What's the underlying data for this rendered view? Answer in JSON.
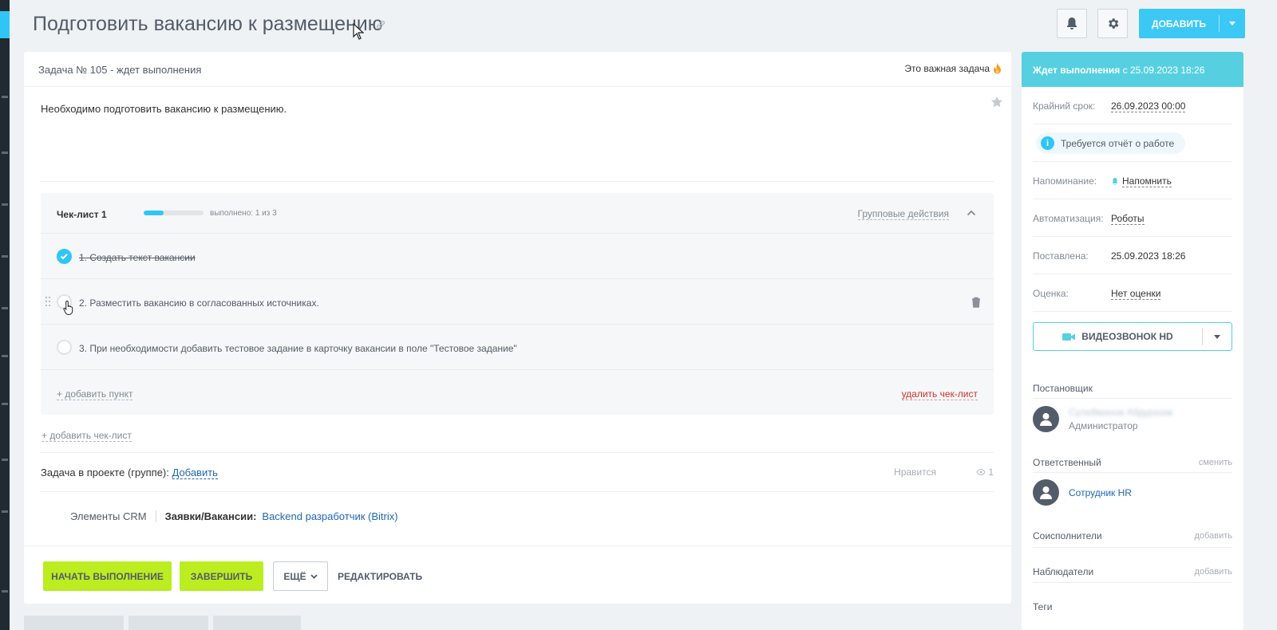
{
  "header": {
    "title": "Подготовить вакансию к размещению",
    "add_label": "ДОБАВИТЬ"
  },
  "task": {
    "heading": "Задача № 105 - ждет выполнения",
    "important_label": "Это важная задача",
    "description": "Необходимо подготовить вакансию к размещению."
  },
  "checklist": {
    "title": "Чек-лист 1",
    "progress": 0.333,
    "done_text": "выполнено: 1 из 3",
    "group_actions": "Групповые действия",
    "items": [
      {
        "text": "1. Создать текст вакансии",
        "done": true
      },
      {
        "text": "2. Разместить вакансию в согласованных источниках.",
        "done": false
      },
      {
        "text": "3. При необходимости добавить тестовое задание в карточку вакансии в поле \"Тестовое задание\"",
        "done": false
      }
    ],
    "add_item": "+ добавить пункт",
    "delete_checklist": "удалить чек-лист"
  },
  "add_checklist": "+ добавить чек-лист",
  "project": {
    "label": "Задача в проекте (группе):",
    "link": "Добавить"
  },
  "likes_label": "Нравится",
  "views_count": "1",
  "crm": {
    "label": "Элементы CRM",
    "type": "Заявки/Вакансии:",
    "value": "Backend разработчик (Bitrix)"
  },
  "buttons": {
    "start": "НАЧАТЬ ВЫПОЛНЕНИЕ",
    "finish": "ЗАВЕРШИТЬ",
    "more": "ЕЩЁ",
    "edit": "РЕДАКТИРОВАТЬ"
  },
  "sidebar": {
    "status": "Ждет выполнения",
    "status_since": "с 25.09.2023 18:26",
    "deadline_label": "Крайний срок:",
    "deadline_value": "26.09.2023 00:00",
    "report_required": "Требуется отчёт о работе",
    "reminder_label": "Напоминание:",
    "reminder_value": "Напомнить",
    "automation_label": "Автоматизация:",
    "automation_value": "Роботы",
    "created_label": "Поставлена:",
    "created_value": "25.09.2023 18:26",
    "rating_label": "Оценка:",
    "rating_value": "Нет оценки",
    "video_call": "ВИДЕОЗВОНОК HD",
    "creator_title": "Постановщик",
    "creator_name": "Сулейманов Абдуразак",
    "creator_role": "Администратор",
    "responsible_title": "Ответственный",
    "responsible_change": "сменить",
    "responsible_name": "Сотрудник HR",
    "coexecutors_title": "Соисполнители",
    "coexecutors_add": "добавить",
    "observers_title": "Наблюдатели",
    "observers_add": "добавить",
    "tags_title": "Теги"
  },
  "colors": {
    "accent": "#2fc6f6",
    "status_bar": "#56d0e0",
    "green_button": "#bbed21",
    "link": "#2067b0",
    "danger": "#d0312d"
  }
}
